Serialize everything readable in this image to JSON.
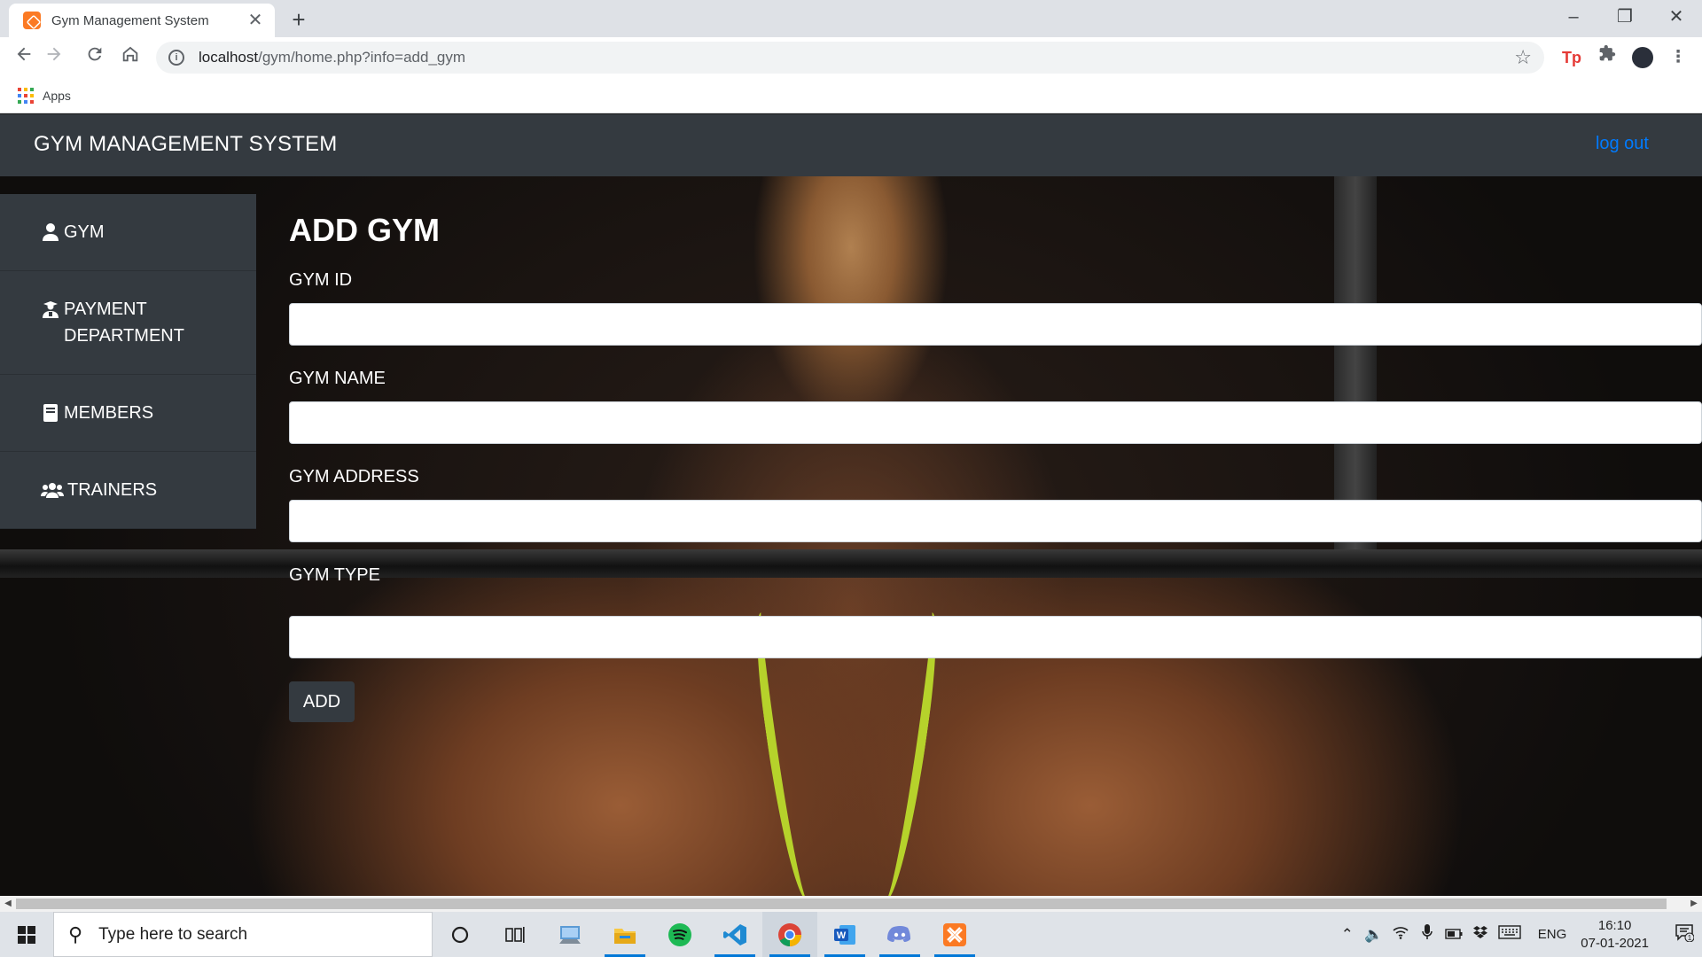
{
  "browser": {
    "tab_title": "Gym Management System",
    "tab_close": "✕",
    "new_tab": "+",
    "url_host": "localhost",
    "url_path": "/gym/home.php?info=add_gym",
    "bookmarks": {
      "apps_label": "Apps"
    },
    "window_controls": {
      "minimize": "–",
      "maximize": "❐",
      "close": "✕"
    }
  },
  "navbar": {
    "brand": "GYM MANAGEMENT SYSTEM",
    "logout": "log out"
  },
  "sidebar": {
    "items": [
      {
        "label": "GYM",
        "icon": "user-icon"
      },
      {
        "label": "PAYMENT DEPARTMENT",
        "icon": "user-graduate-icon"
      },
      {
        "label": "MEMBERS",
        "icon": "book-icon"
      },
      {
        "label": "TRAINERS",
        "icon": "users-icon"
      }
    ]
  },
  "form": {
    "title": "ADD GYM",
    "fields": [
      {
        "label": "GYM ID",
        "value": ""
      },
      {
        "label": "GYM NAME",
        "value": ""
      },
      {
        "label": "GYM ADDRESS",
        "value": ""
      },
      {
        "label": "GYM TYPE",
        "value": ""
      }
    ],
    "submit_label": "ADD"
  },
  "taskbar": {
    "search_placeholder": "Type here to search",
    "apps": [
      "cortana-icon",
      "task-view-icon",
      "remote-desktop-icon",
      "file-explorer-icon",
      "spotify-icon",
      "vscode-icon",
      "chrome-icon",
      "word-icon",
      "discord-icon",
      "xampp-icon"
    ],
    "language": "ENG",
    "time": "16:10",
    "date": "07-01-2021",
    "notification_count": "1"
  },
  "colors": {
    "navbar_bg": "#343a40",
    "link": "#007bff",
    "taskbar_bg": "#dfe3e8",
    "accent": "#0078d7"
  }
}
